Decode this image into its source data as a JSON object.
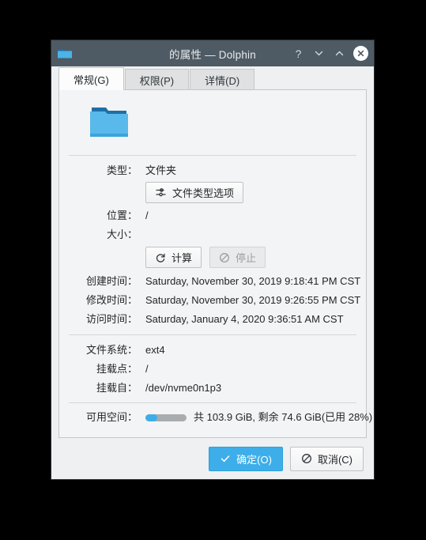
{
  "window": {
    "title": "的属性 — Dolphin",
    "icon": "folder-icon",
    "controls": {
      "help": "?",
      "shade_down": "chevron-down-icon",
      "shade_up": "chevron-up-icon",
      "close": "close-icon"
    }
  },
  "tabs": [
    {
      "label": "常规(G)",
      "active": true
    },
    {
      "label": "权限(P)",
      "active": false
    },
    {
      "label": "详情(D)",
      "active": false
    }
  ],
  "general": {
    "type_label": "类型：",
    "type_value": "文件夹",
    "file_type_options_button": "文件类型选项",
    "location_label": "位置：",
    "location_value": "/",
    "size_label": "大小：",
    "size_value": "",
    "calculate_button": "计算",
    "stop_button": "停止",
    "created_label": "创建时间：",
    "created_value": "Saturday, November 30, 2019 9:18:41 PM CST",
    "modified_label": "修改时间：",
    "modified_value": "Saturday, November 30, 2019 9:26:55 PM CST",
    "accessed_label": "访问时间：",
    "accessed_value": "Saturday, January 4, 2020 9:36:51 AM CST",
    "filesystem_label": "文件系统：",
    "filesystem_value": "ext4",
    "mountpoint_label": "挂载点：",
    "mountpoint_value": "/",
    "mountedfrom_label": "挂载自：",
    "mountedfrom_value": "/dev/nvme0n1p3",
    "freespace_label": "可用空间：",
    "freespace_value": "共 103.9 GiB, 剩余 74.6 GiB(已用 28%)",
    "used_percent": 28
  },
  "footer": {
    "ok_button": "确定(O)",
    "cancel_button": "取消(C)"
  },
  "colors": {
    "titlebar": "#4e5a64",
    "accent": "#3daee9",
    "panel": "#f3f4f5",
    "folder": "#4ab3e8"
  }
}
